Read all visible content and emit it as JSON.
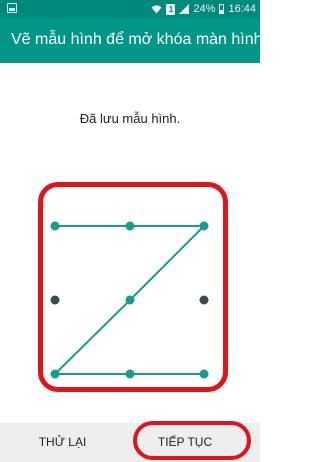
{
  "status_bar": {
    "battery_percent": "24%",
    "time": "16:44",
    "sim_label": "1",
    "icons": [
      "notification-icon",
      "wifi-icon",
      "sim-icon",
      "signal-icon",
      "battery-icon"
    ]
  },
  "app_bar": {
    "title": "Vẽ mẫu hình để mở khóa màn hình",
    "background": "#029688"
  },
  "message": "Đã lưu mẫu hình.",
  "pattern": {
    "selected_sequence": [
      1,
      2,
      3,
      5,
      7,
      8,
      9
    ],
    "unselected_dots": [
      4,
      6
    ],
    "line_color": "#1a9b8d",
    "dot_active_color": "#1a9b8d",
    "dot_inactive_color": "#3a4a54",
    "highlight_color": "#e0141c"
  },
  "buttons": {
    "retry_label": "THỬ LẠI",
    "continue_label": "TIẾP TỤC"
  }
}
